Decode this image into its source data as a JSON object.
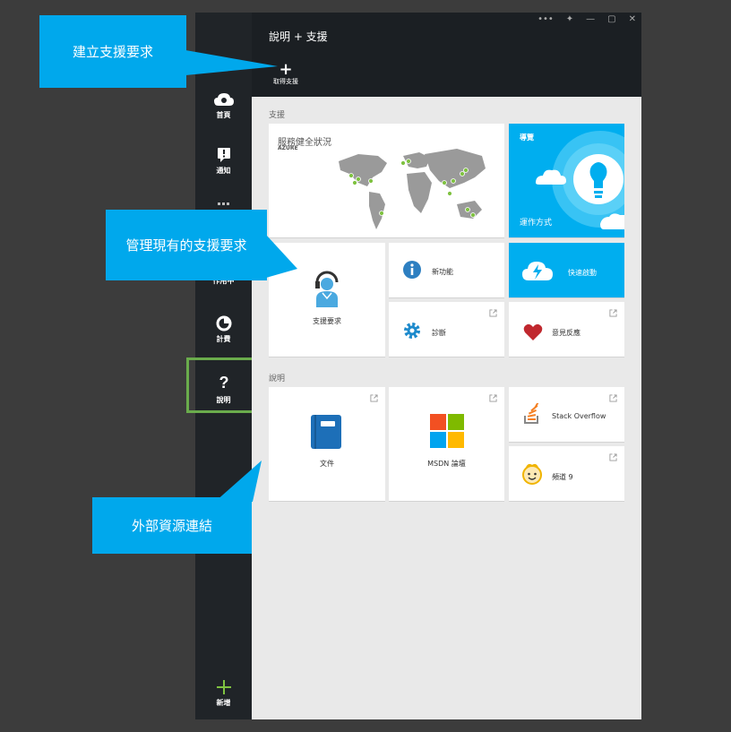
{
  "window": {
    "controls": [
      "•••",
      "✦",
      "—",
      "▢",
      "✕"
    ]
  },
  "nav": {
    "home_label": "首頁",
    "notify_label": "通知",
    "active_label": "作用中",
    "billing_label": "計費",
    "help_label": "說明",
    "new_label": "新增"
  },
  "blade": {
    "title": "說明 + 支援",
    "command_label": "取得支援",
    "support_section": "支援",
    "help_section": "說明"
  },
  "tiles": {
    "health_title": "服務健全狀況",
    "health_sub": "AZURE",
    "tour_title": "導覽",
    "tour_sub": "運作方式",
    "support_request": "支援要求",
    "whats_new": "新功能",
    "quickstart": "快速啟動",
    "diagnostics": "診斷",
    "feedback": "意見反應",
    "docs": "文件",
    "msdn": "MSDN 論壇",
    "stackoverflow": "Stack Overflow",
    "channel9": "頻道 9"
  },
  "callouts": {
    "create": "建立支援要求",
    "manage": "管理現有的支援要求",
    "external": "外部資源連結"
  },
  "colors": {
    "accent": "#00aeef",
    "nav_bg": "#202428",
    "highlight": "#6aac4c"
  }
}
